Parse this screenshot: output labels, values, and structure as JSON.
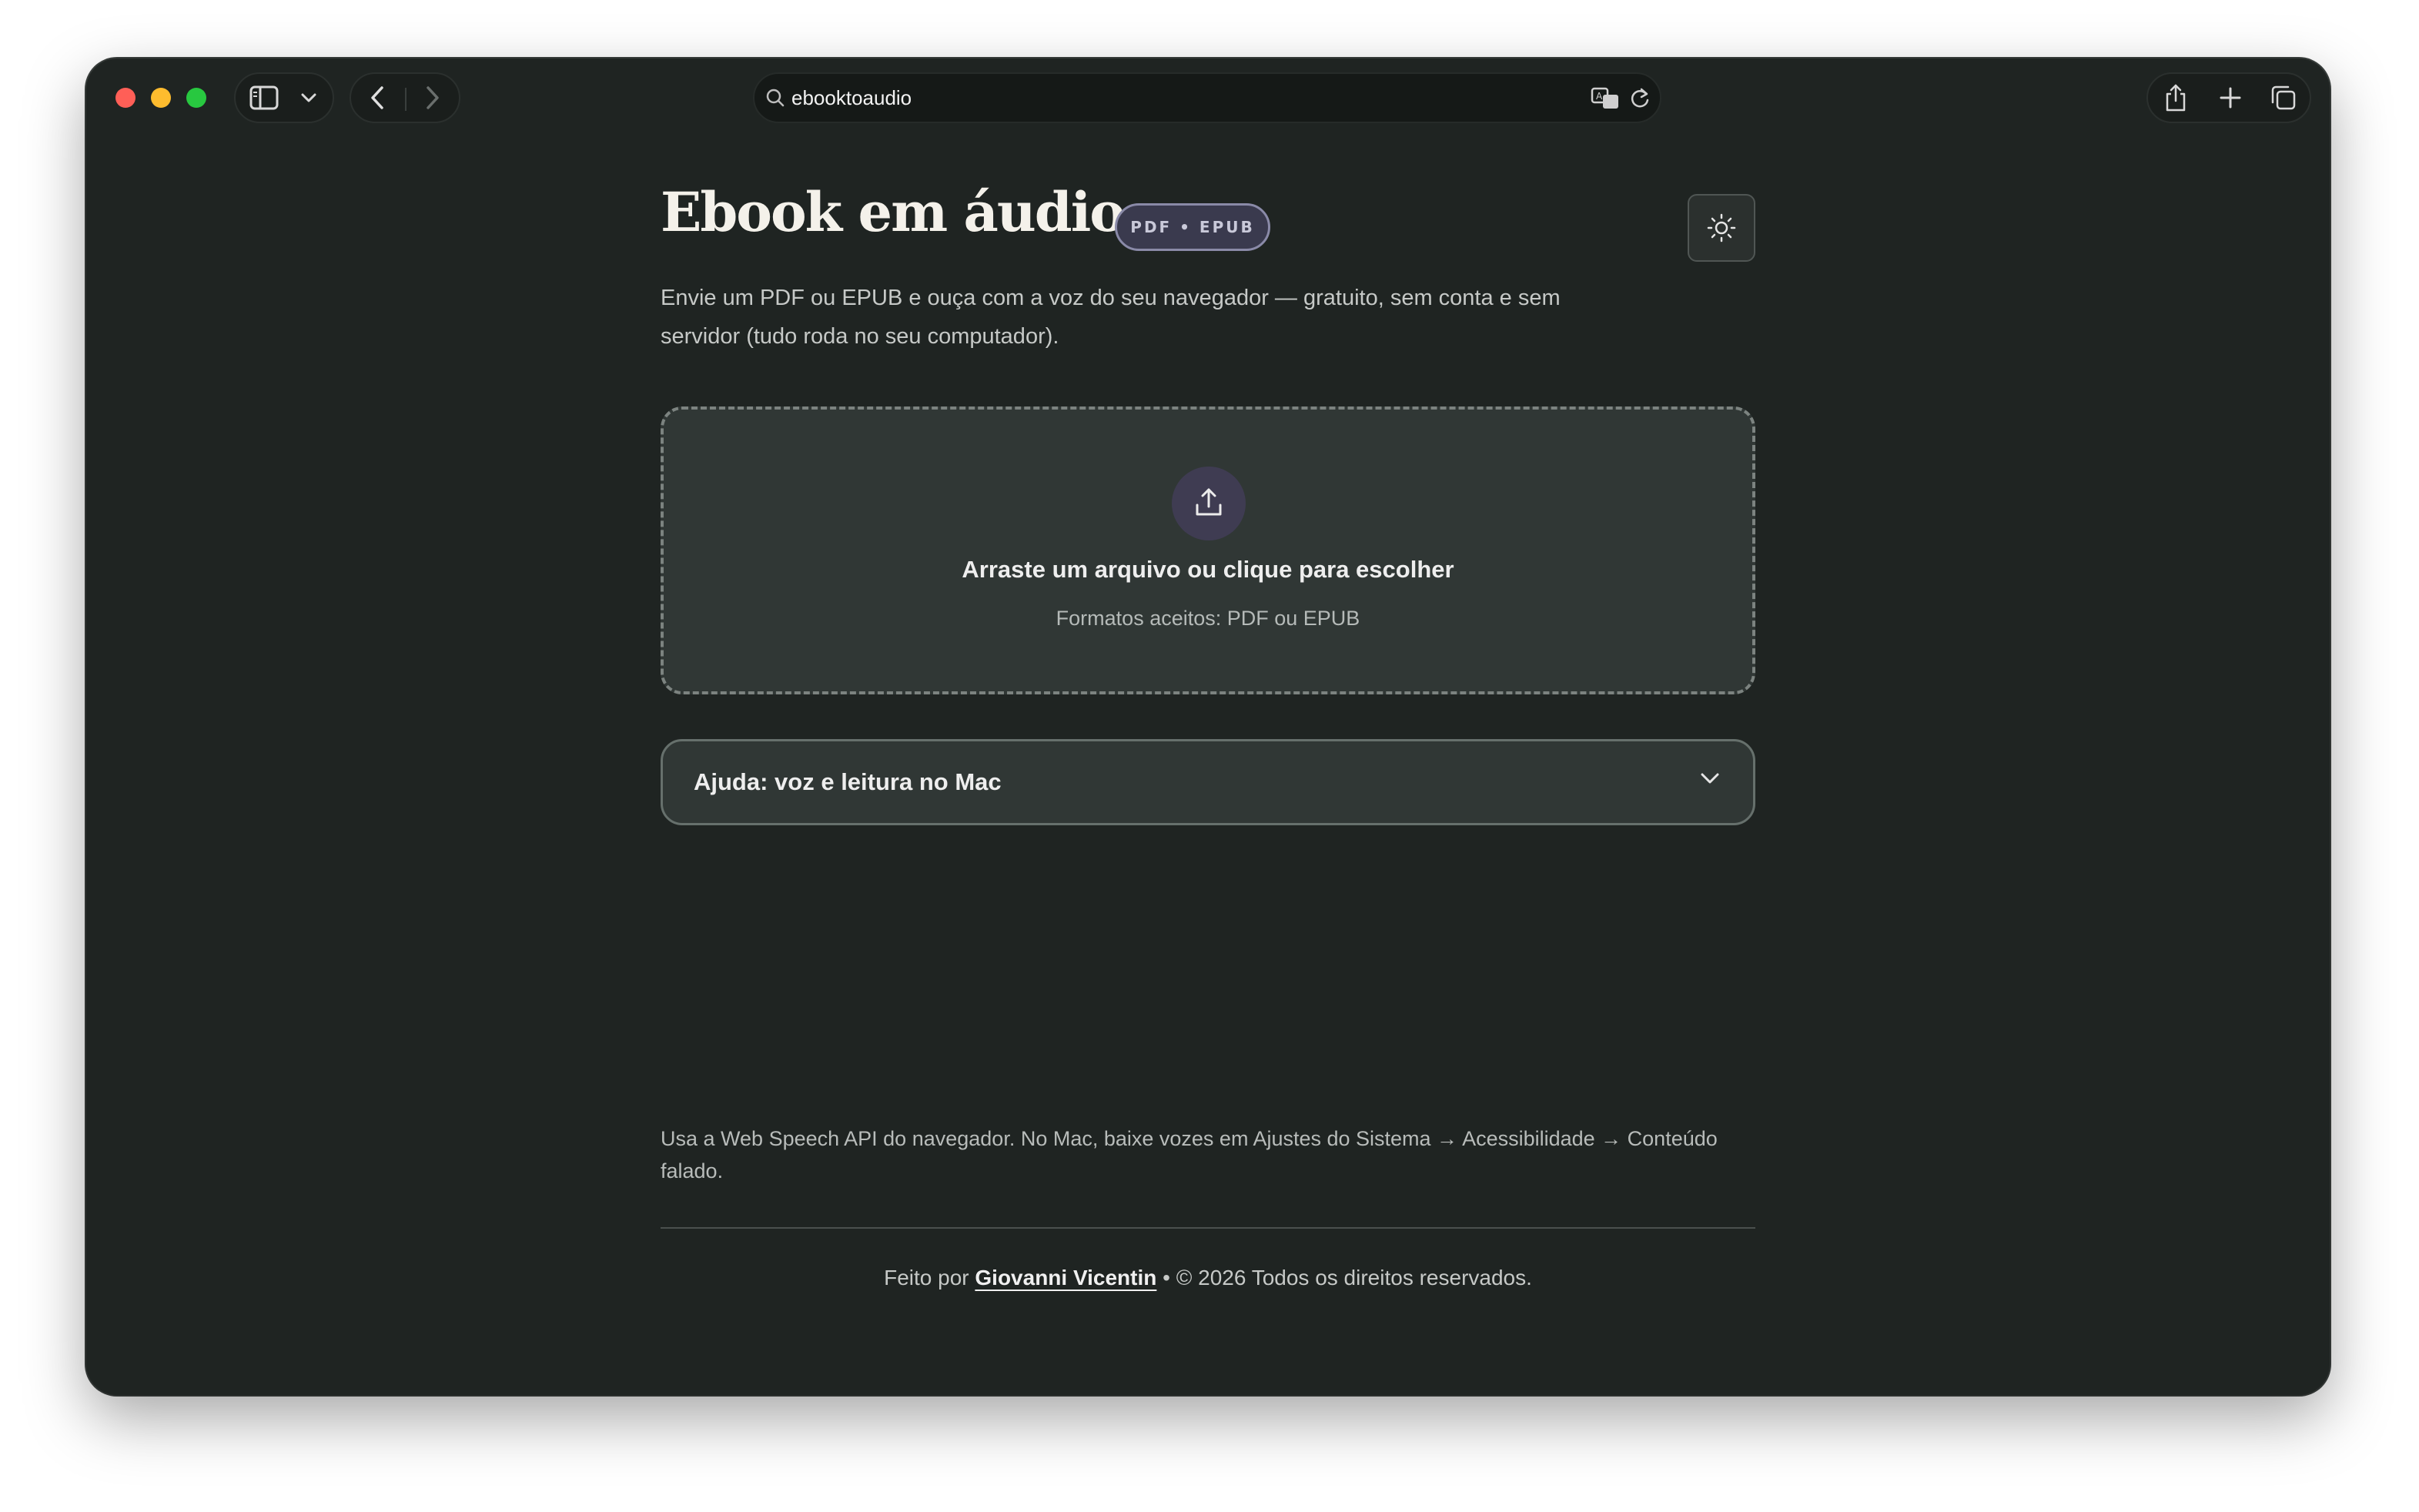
{
  "browser": {
    "address": "ebooktoaudio"
  },
  "header": {
    "title": "Ebook em áudio",
    "badge": "PDF • EPUB",
    "subtitle": "Envie um PDF ou EPUB e ouça com a voz do seu navegador — gratuito, sem conta e sem servidor (tudo roda no seu computador)."
  },
  "dropzone": {
    "title": "Arraste um arquivo ou clique para escolher",
    "formats": "Formatos aceitos: PDF ou EPUB"
  },
  "help": {
    "label": "Ajuda: voz e leitura no Mac"
  },
  "note": "Usa a Web Speech API do navegador. No Mac, baixe vozes em Ajustes do Sistema → Acessibilidade → Conteúdo falado.",
  "footer": {
    "prefix": "Feito por",
    "author": "Giovanni Vicentin",
    "suffix": "• © 2026 Todos os direitos reservados."
  },
  "icons": {
    "theme": "sun-icon",
    "upload": "upload-icon",
    "help_toggle": "chevron-down-icon"
  },
  "colors": {
    "background": "#1f2422",
    "card": "#303735",
    "badge_border": "#8a8aa8",
    "upload_circle": "#3f3c52"
  }
}
